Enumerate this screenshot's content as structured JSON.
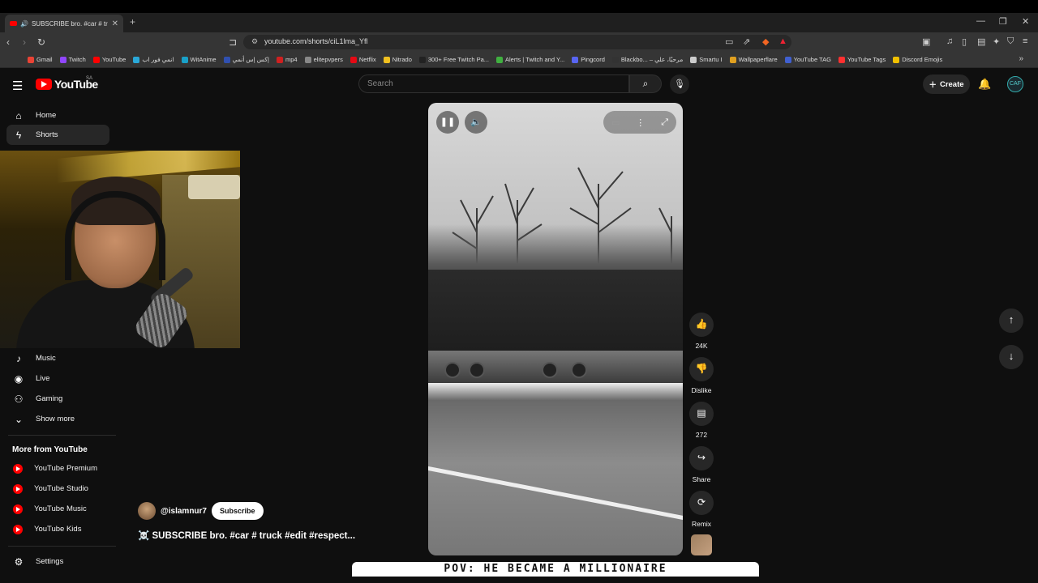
{
  "browser": {
    "tab_title": "SUBSCRIBE bro. #car # tr",
    "url": "youtube.com/shorts/ciL1lma_Yfl",
    "new_tab_glyph": "+",
    "bookmarks": [
      {
        "label": "Gmail",
        "color": "#ea4335"
      },
      {
        "label": "Twitch",
        "color": "#9146ff"
      },
      {
        "label": "YouTube",
        "color": "#ff0000"
      },
      {
        "label": "انمي فور اب",
        "color": "#2aa8d8"
      },
      {
        "label": "WitAnime",
        "color": "#19a0c8"
      },
      {
        "label": "إكس إس أنمي",
        "color": "#3050b0"
      },
      {
        "label": "mp4",
        "color": "#d02020"
      },
      {
        "label": "elitepvpers",
        "color": "#888888"
      },
      {
        "label": "Netflix",
        "color": "#e50914"
      },
      {
        "label": "Nitrado",
        "color": "#f0c020"
      },
      {
        "label": "300+ Free Twitch Pa...",
        "color": "#222222"
      },
      {
        "label": "Alerts | Twitch and Y...",
        "color": "#40b040"
      },
      {
        "label": "Pingcord",
        "color": "#5865f2"
      },
      {
        "label": "Blackbo... – مرحبًا، علي",
        "color": "#333333"
      },
      {
        "label": "Smartu I",
        "color": "#cccccc"
      },
      {
        "label": "Wallpaperflare",
        "color": "#e0a020"
      },
      {
        "label": "YouTube TAG",
        "color": "#4060d0"
      },
      {
        "label": "YouTube Tags",
        "color": "#ff3030"
      },
      {
        "label": "Discord Emojis",
        "color": "#f0c000"
      }
    ]
  },
  "header": {
    "logo_text": "YouTube",
    "region": "SA",
    "search_placeholder": "Search",
    "create_label": "Create",
    "account_initials": "CAF"
  },
  "sidebar": {
    "top_items": [
      {
        "label": "Home",
        "icon": "home-icon"
      },
      {
        "label": "Shorts",
        "icon": "shorts-icon"
      }
    ],
    "explore_items": [
      {
        "label": "Music",
        "icon": "music-icon"
      },
      {
        "label": "Live",
        "icon": "live-icon"
      },
      {
        "label": "Gaming",
        "icon": "gaming-icon"
      },
      {
        "label": "Show more",
        "icon": "chevron-down-icon"
      }
    ],
    "more_heading": "More from YouTube",
    "more_items": [
      {
        "label": "YouTube Premium"
      },
      {
        "label": "YouTube Studio"
      },
      {
        "label": "YouTube Music"
      },
      {
        "label": "YouTube Kids"
      }
    ],
    "settings_label": "Settings"
  },
  "short": {
    "channel": "@islamnur7",
    "subscribe_label": "Subscribe",
    "title": "☠️ SUBSCRIBE bro.  #car # truck #edit #respect...",
    "overlay_caption": "POV: HE BECAME A MILLIONAIRE",
    "likes": "24K",
    "dislike_label": "Dislike",
    "comments": "272",
    "share_label": "Share",
    "remix_label": "Remix"
  },
  "colors": {
    "background": "#0f0f0f",
    "accent": "#ff0000"
  }
}
